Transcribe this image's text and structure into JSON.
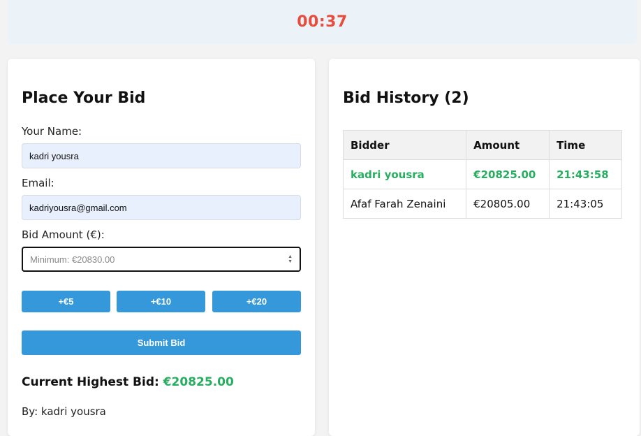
{
  "timer": "00:37",
  "bid_form": {
    "title": "Place Your Bid",
    "name_label": "Your Name:",
    "name_value": "kadri yousra",
    "email_label": "Email:",
    "email_value": "kadriyousra@gmail.com",
    "amount_label": "Bid Amount (€):",
    "amount_placeholder": "Minimum: €20830.00",
    "increments": [
      "+€5",
      "+€10",
      "+€20"
    ],
    "submit_label": "Submit Bid",
    "highest_label": "Current Highest Bid:",
    "highest_value": "€20825.00",
    "by_text": "By: kadri yousra"
  },
  "history": {
    "title": "Bid History (2)",
    "columns": [
      "Bidder",
      "Amount",
      "Time"
    ],
    "rows": [
      {
        "bidder": "kadri yousra",
        "amount": "€20825.00",
        "time": "21:43:58"
      },
      {
        "bidder": "Afaf Farah Zenaini",
        "amount": "€20805.00",
        "time": "21:43:05"
      }
    ]
  },
  "colors": {
    "accent": "#3498db",
    "timer": "#e74c3c",
    "highlight": "#27ae60"
  }
}
